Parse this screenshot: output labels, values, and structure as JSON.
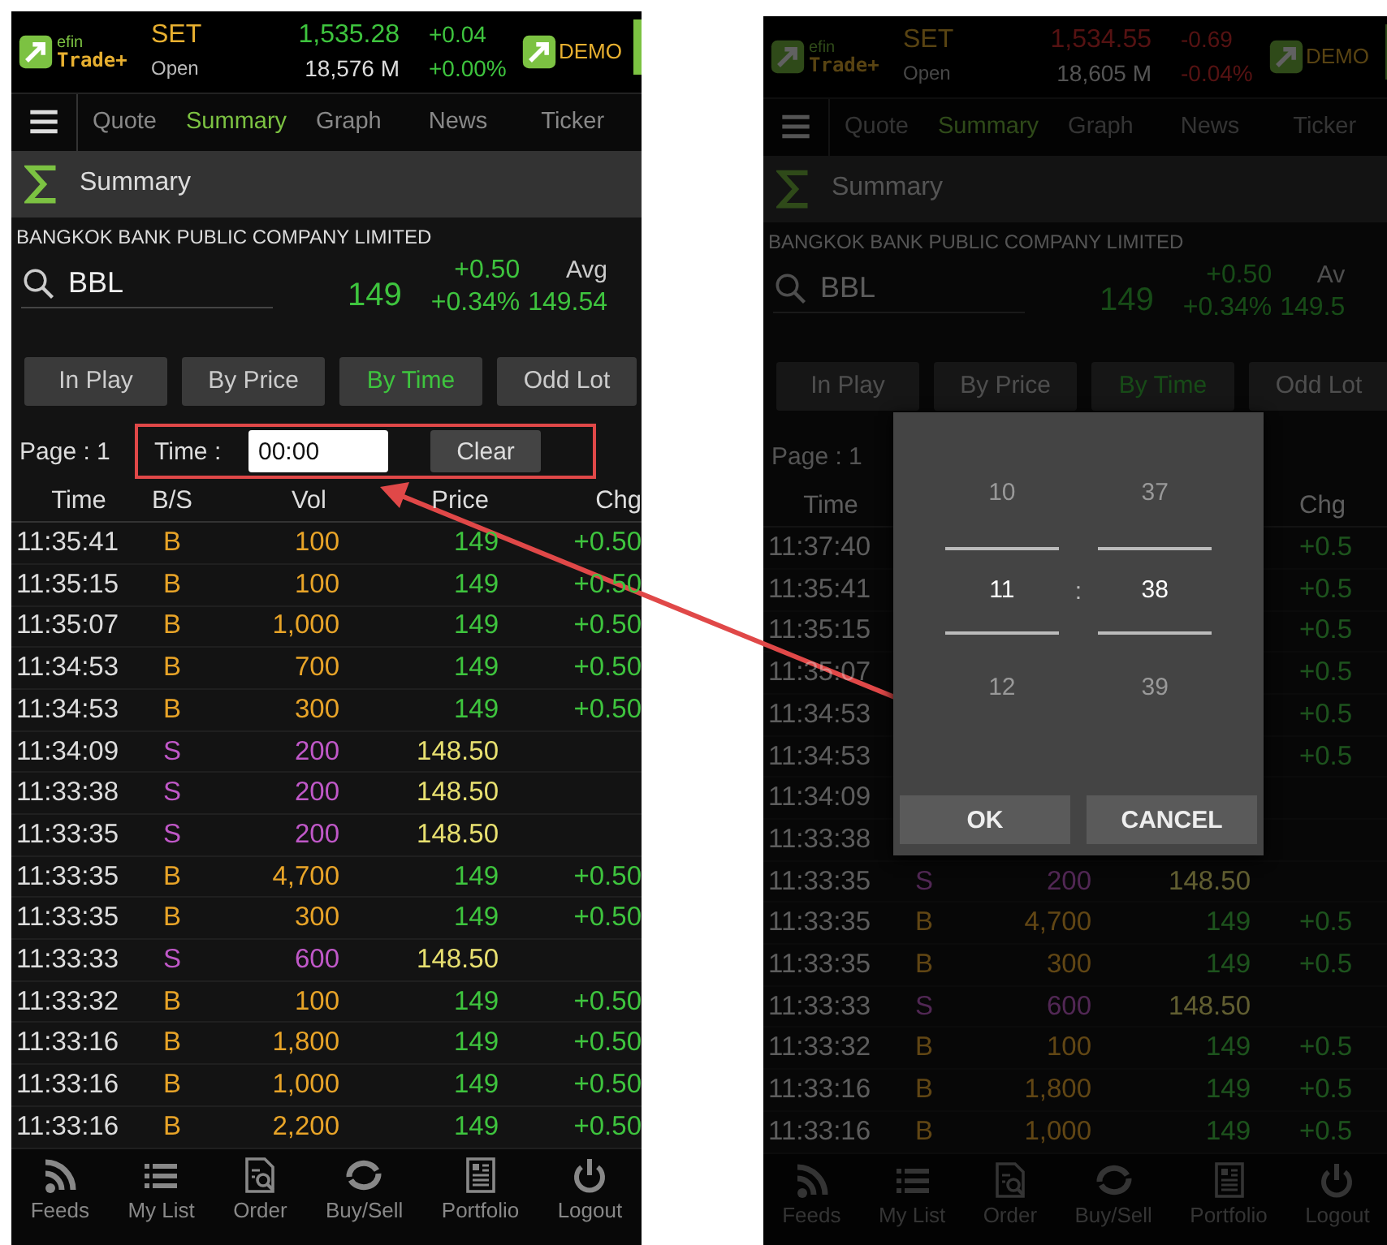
{
  "callout_arrow": true,
  "screens": [
    {
      "logo": {
        "line1": "efin",
        "line2": "Trade+"
      },
      "market": {
        "name": "SET",
        "state": "Open"
      },
      "index": {
        "value": "1,535.28",
        "volume": "18,576 M",
        "change": "+0.04",
        "percent": "+0.00%",
        "up": true
      },
      "badge": "DEMO",
      "tabs": [
        {
          "label": "Quote",
          "selected": false
        },
        {
          "label": "Summary",
          "selected": true
        },
        {
          "label": "Graph",
          "selected": false
        },
        {
          "label": "News",
          "selected": false
        },
        {
          "label": "Ticker",
          "selected": false
        }
      ],
      "section_title": "Summary",
      "company": "BANGKOK BANK PUBLIC COMPANY LIMITED",
      "quote": {
        "symbol": "BBL",
        "last": "149",
        "change": "+0.50",
        "percent": "+0.34%",
        "avg_label": "Avg",
        "avg": "149.54"
      },
      "segments": [
        {
          "label": "In Play",
          "selected": false
        },
        {
          "label": "By Price",
          "selected": false
        },
        {
          "label": "By Time",
          "selected": true
        },
        {
          "label": "Odd Lot",
          "selected": false
        }
      ],
      "page_label": "Page : 1",
      "time_filter": {
        "label": "Time :",
        "value": "00:00",
        "button": "Clear",
        "highlighted": true
      },
      "columns": {
        "time": "Time",
        "side": "B/S",
        "vol": "Vol",
        "price": "Price",
        "chg": "Chg"
      },
      "rows": [
        {
          "time": "11:35:41",
          "side": "B",
          "vol": "100",
          "price": "149",
          "chg": "+0.50",
          "kind": "buy",
          "price_up": true
        },
        {
          "time": "11:35:15",
          "side": "B",
          "vol": "100",
          "price": "149",
          "chg": "+0.50",
          "kind": "buy",
          "price_up": true
        },
        {
          "time": "11:35:07",
          "side": "B",
          "vol": "1,000",
          "price": "149",
          "chg": "+0.50",
          "kind": "buy",
          "price_up": true
        },
        {
          "time": "11:34:53",
          "side": "B",
          "vol": "700",
          "price": "149",
          "chg": "+0.50",
          "kind": "buy",
          "price_up": true
        },
        {
          "time": "11:34:53",
          "side": "B",
          "vol": "300",
          "price": "149",
          "chg": "+0.50",
          "kind": "buy",
          "price_up": true
        },
        {
          "time": "11:34:09",
          "side": "S",
          "vol": "200",
          "price": "148.50",
          "kind": "sell",
          "price_up": false
        },
        {
          "time": "11:33:38",
          "side": "S",
          "vol": "200",
          "price": "148.50",
          "kind": "sell",
          "price_up": false
        },
        {
          "time": "11:33:35",
          "side": "S",
          "vol": "200",
          "price": "148.50",
          "kind": "sell",
          "price_up": false
        },
        {
          "time": "11:33:35",
          "side": "B",
          "vol": "4,700",
          "price": "149",
          "chg": "+0.50",
          "kind": "buy",
          "price_up": true
        },
        {
          "time": "11:33:35",
          "side": "B",
          "vol": "300",
          "price": "149",
          "chg": "+0.50",
          "kind": "buy",
          "price_up": true
        },
        {
          "time": "11:33:33",
          "side": "S",
          "vol": "600",
          "price": "148.50",
          "kind": "sell",
          "price_up": false
        },
        {
          "time": "11:33:32",
          "side": "B",
          "vol": "100",
          "price": "149",
          "chg": "+0.50",
          "kind": "buy",
          "price_up": true
        },
        {
          "time": "11:33:16",
          "side": "B",
          "vol": "1,800",
          "price": "149",
          "chg": "+0.50",
          "kind": "buy",
          "price_up": true
        },
        {
          "time": "11:33:16",
          "side": "B",
          "vol": "1,000",
          "price": "149",
          "chg": "+0.50",
          "kind": "buy",
          "price_up": true
        },
        {
          "time": "11:33:16",
          "side": "B",
          "vol": "2,200",
          "price": "149",
          "chg": "+0.50",
          "kind": "buy",
          "price_up": true
        }
      ],
      "nav": [
        "Feeds",
        "My List",
        "Order",
        "Buy/Sell",
        "Portfolio",
        "Logout"
      ]
    },
    {
      "logo": {
        "line1": "efin",
        "line2": "Trade+"
      },
      "market": {
        "name": "SET",
        "state": "Open"
      },
      "index": {
        "value": "1,534.55",
        "volume": "18,605 M",
        "change": "-0.69",
        "percent": "-0.04%",
        "up": false
      },
      "badge": "DEMO",
      "tabs": [
        {
          "label": "Quote",
          "selected": false
        },
        {
          "label": "Summary",
          "selected": true
        },
        {
          "label": "Graph",
          "selected": false
        },
        {
          "label": "News",
          "selected": false
        },
        {
          "label": "Ticker",
          "selected": false
        }
      ],
      "section_title": "Summary",
      "company": "BANGKOK BANK PUBLIC COMPANY LIMITED",
      "quote": {
        "symbol": "BBL",
        "last": "149",
        "change": "+0.50",
        "percent": "+0.34%",
        "avg_label": "Av",
        "avg": "149.5"
      },
      "segments": [
        {
          "label": "In Play",
          "selected": false
        },
        {
          "label": "By Price",
          "selected": false
        },
        {
          "label": "By Time",
          "selected": true
        },
        {
          "label": "Odd Lot",
          "selected": false
        }
      ],
      "page_label": "Page : 1",
      "columns": {
        "time": "Time",
        "chg": "Chg"
      },
      "rows": [
        {
          "time": "11:37:40",
          "chg": "+0.5",
          "kind": "buy"
        },
        {
          "time": "11:35:41",
          "chg": "+0.5",
          "kind": "buy"
        },
        {
          "time": "11:35:15",
          "chg": "+0.5",
          "kind": "buy"
        },
        {
          "time": "11:35:07",
          "chg": "+0.5",
          "kind": "buy"
        },
        {
          "time": "11:34:53",
          "chg": "+0.5",
          "kind": "buy"
        },
        {
          "time": "11:34:53",
          "chg": "+0.5",
          "kind": "buy"
        },
        {
          "time": "11:34:09",
          "kind": "sell"
        },
        {
          "time": "11:33:38",
          "kind": "sell"
        },
        {
          "time": "11:33:35",
          "side": "S",
          "vol": "200",
          "price": "148.50",
          "kind": "sell",
          "price_up": false
        },
        {
          "time": "11:33:35",
          "side": "B",
          "vol": "4,700",
          "price": "149",
          "chg": "+0.5",
          "kind": "buy",
          "price_up": true
        },
        {
          "time": "11:33:35",
          "side": "B",
          "vol": "300",
          "price": "149",
          "chg": "+0.5",
          "kind": "buy",
          "price_up": true
        },
        {
          "time": "11:33:33",
          "side": "S",
          "vol": "600",
          "price": "148.50",
          "kind": "sell",
          "price_up": false
        },
        {
          "time": "11:33:32",
          "side": "B",
          "vol": "100",
          "price": "149",
          "chg": "+0.5",
          "kind": "buy",
          "price_up": true
        },
        {
          "time": "11:33:16",
          "side": "B",
          "vol": "1,800",
          "price": "149",
          "chg": "+0.5",
          "kind": "buy",
          "price_up": true
        },
        {
          "time": "11:33:16",
          "side": "B",
          "vol": "1,000",
          "price": "149",
          "chg": "+0.5",
          "kind": "buy",
          "price_up": true
        }
      ],
      "nav": [
        "Feeds",
        "My List",
        "Order",
        "Buy/Sell",
        "Portfolio",
        "Logout"
      ],
      "dialog": {
        "hour": {
          "prev": "10",
          "current": "11",
          "next": "12"
        },
        "separator": ":",
        "minute": {
          "prev": "37",
          "current": "38",
          "next": "39"
        },
        "buttons": [
          "OK",
          "CANCEL"
        ]
      }
    }
  ]
}
